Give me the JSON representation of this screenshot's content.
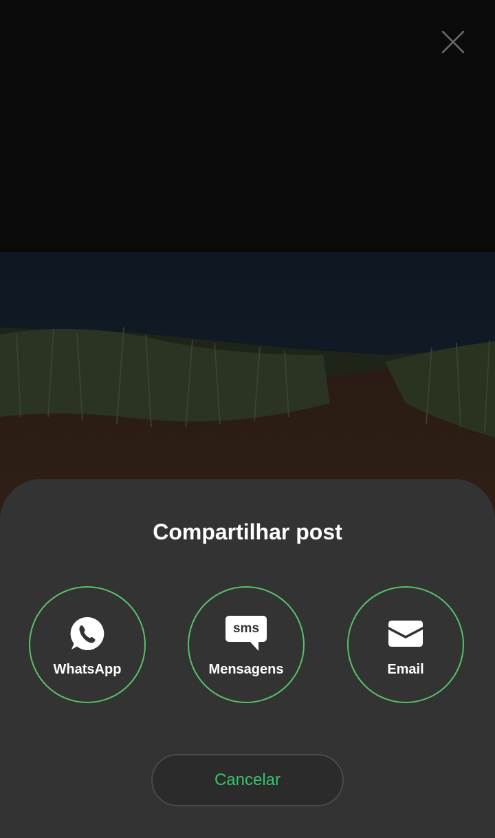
{
  "sheet": {
    "title": "Compartilhar post",
    "options": [
      {
        "label": "WhatsApp",
        "icon": "whatsapp-icon"
      },
      {
        "label": "Mensagens",
        "icon": "sms-icon",
        "icon_text": "sms"
      },
      {
        "label": "Email",
        "icon": "email-icon"
      }
    ],
    "cancel_label": "Cancelar"
  },
  "header": {
    "close_icon": "close-icon"
  },
  "colors": {
    "accent": "#37c46a",
    "ring": "#58c26a",
    "sheet_background": "#333333",
    "page_background": "#0a0a0a"
  }
}
